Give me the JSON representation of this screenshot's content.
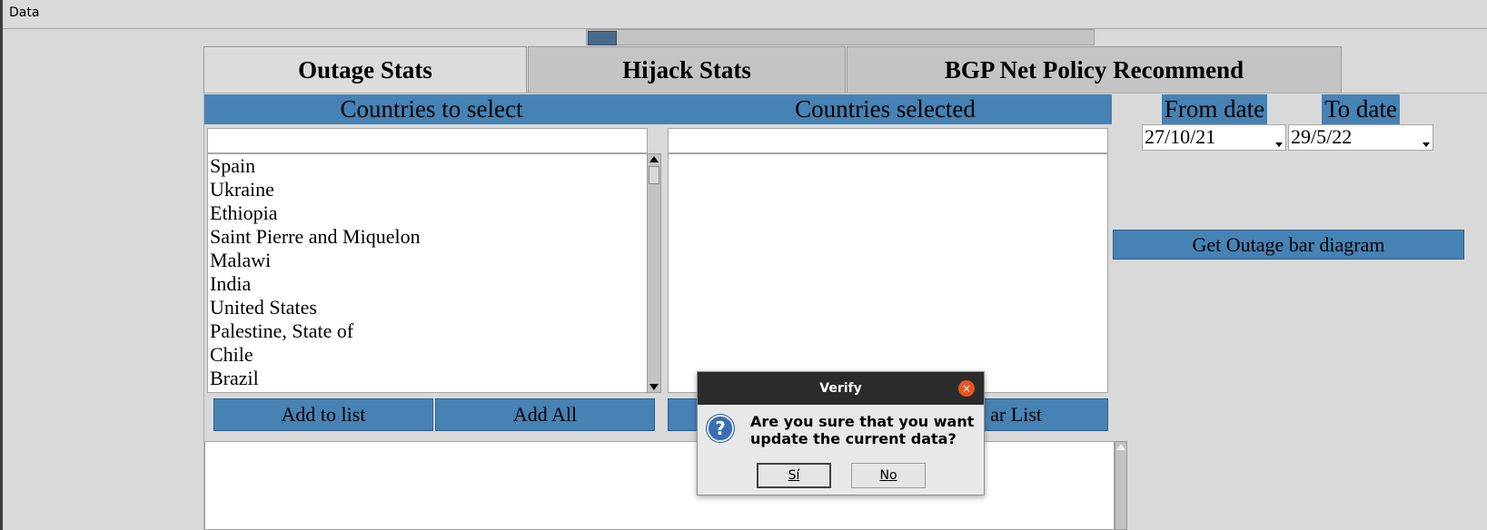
{
  "menubar": {
    "items": [
      "Data"
    ]
  },
  "tabs": [
    {
      "label": "Outage Stats",
      "active": true
    },
    {
      "label": "Hijack Stats",
      "active": false
    },
    {
      "label": "BGP Net Policy Recommend",
      "active": false
    }
  ],
  "outage": {
    "countries_to_select_header": "Countries to select",
    "countries_selected_header": "Countries selected",
    "search_left_value": "",
    "search_right_value": "",
    "available_countries": [
      "Spain",
      "Ukraine",
      "Ethiopia",
      "Saint Pierre and Miquelon",
      "Malawi",
      "India",
      "United States",
      "Palestine, State of",
      "Chile",
      "Brazil"
    ],
    "selected_countries": [],
    "add_to_list_label": "Add to list",
    "add_all_label": "Add All",
    "clear_list_label_visible": "ar List",
    "from_date_header": "From date",
    "to_date_header": "To date",
    "from_date_value": "27/10/21",
    "to_date_value": "29/5/22",
    "get_diagram_label": "Get Outage bar diagram"
  },
  "dialog": {
    "title": "Verify",
    "close_glyph": "×",
    "icon_glyph": "?",
    "message": "Are you sure that you want update the current data?",
    "yes_label": "Sí",
    "no_label": "No"
  },
  "colors": {
    "accent_blue": "#4682b4",
    "dialog_titlebar": "#2b2b2b",
    "close_button": "#e95420"
  }
}
